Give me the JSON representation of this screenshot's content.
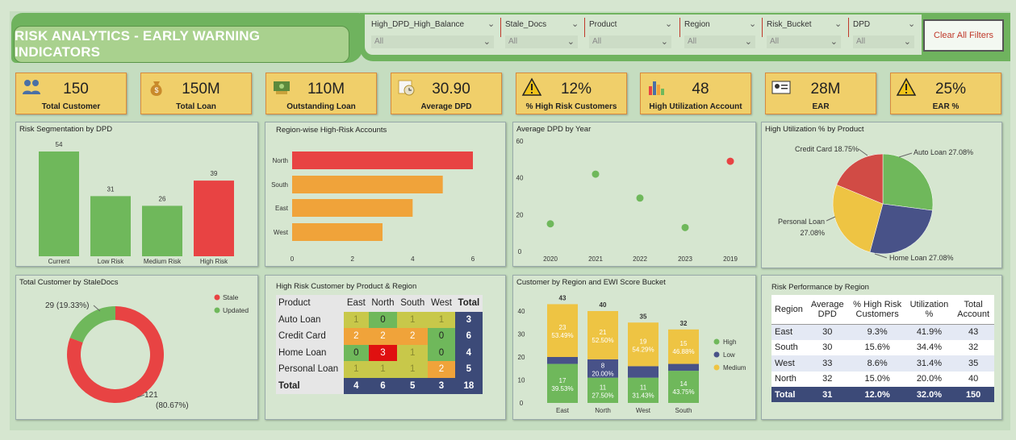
{
  "title": "RISK ANALYTICS - EARLY WARNING INDICATORS",
  "filters": [
    {
      "label": "High_DPD_High_Balance",
      "value": "All"
    },
    {
      "label": "Stale_Docs",
      "value": "All"
    },
    {
      "label": "Product",
      "value": "All"
    },
    {
      "label": "Region",
      "value": "All"
    },
    {
      "label": "Risk_Bucket",
      "value": "All"
    },
    {
      "label": "DPD",
      "value": "All"
    }
  ],
  "clear_label": "Clear All Filters",
  "kpis": [
    {
      "value": "150",
      "label": "Total Customer",
      "icon": "people-icon"
    },
    {
      "value": "150M",
      "label": "Total Loan",
      "icon": "money-bag-icon"
    },
    {
      "value": "110M",
      "label": "Outstanding Loan",
      "icon": "cash-icon"
    },
    {
      "value": "30.90",
      "label": "Average DPD",
      "icon": "calendar-clock-icon"
    },
    {
      "value": "12%",
      "label": "% High Risk Customers",
      "icon": "warning-icon"
    },
    {
      "value": "48",
      "label": "High Utilization Account",
      "icon": "bar-chart-icon"
    },
    {
      "value": "28M",
      "label": "EAR",
      "icon": "id-card-icon"
    },
    {
      "value": "25%",
      "label": "EAR %",
      "icon": "warning-icon"
    }
  ],
  "colors": {
    "green": "#6fb85b",
    "red": "#e84343",
    "orange": "#f0a33a",
    "yellow": "#eec443",
    "navy": "#485288"
  },
  "chart_data": [
    {
      "type": "bar",
      "title": "Risk Segmentation by DPD",
      "categories": [
        "Current",
        "Low Risk",
        "Medium Risk",
        "High Risk"
      ],
      "values": [
        54,
        31,
        26,
        39
      ],
      "colors": [
        "#6fb85b",
        "#6fb85b",
        "#6fb85b",
        "#e84343"
      ]
    },
    {
      "type": "bar",
      "orientation": "horizontal",
      "title": "Region-wise High-Risk Accounts",
      "categories": [
        "North",
        "South",
        "East",
        "West"
      ],
      "values": [
        6,
        5,
        4,
        3
      ],
      "xticks": [
        0,
        2,
        4,
        6
      ],
      "colors": [
        "#e84343",
        "#f0a33a",
        "#f0a33a",
        "#f0a33a"
      ]
    },
    {
      "type": "scatter",
      "title": "Average DPD by Year",
      "x": [
        "2020",
        "2021",
        "2022",
        "2023",
        "2019"
      ],
      "y": [
        15,
        42,
        29,
        13,
        49
      ],
      "yticks": [
        0,
        20,
        40,
        60
      ],
      "colors": [
        "#6fb85b",
        "#6fb85b",
        "#6fb85b",
        "#6fb85b",
        "#e84343"
      ]
    },
    {
      "type": "pie",
      "title": "High Utilization % by Product",
      "labels": [
        "Auto Loan 27.08%",
        "Home Loan 27.08%",
        "Personal Loan 27.08%",
        "Credit Card 18.75%"
      ],
      "values": [
        27.08,
        27.08,
        27.08,
        18.75
      ],
      "colors": [
        "#6fb85b",
        "#485288",
        "#eec443",
        "#d14b45"
      ]
    },
    {
      "type": "pie",
      "title": "Total Customer by StaleDocs",
      "labels": [
        "Stale",
        "Updated"
      ],
      "values": [
        121,
        29
      ],
      "data_labels": [
        "121\n(80.67%)",
        "29 (19.33%)"
      ],
      "colors": [
        "#e84343",
        "#6fb85b"
      ]
    },
    {
      "type": "bar",
      "stacked": true,
      "title": "Customer by Region and EWI Score Bucket",
      "categories": [
        "East",
        "North",
        "West",
        "South"
      ],
      "totals": [
        43,
        40,
        35,
        32
      ],
      "series": [
        {
          "name": "High",
          "values": [
            17,
            11,
            11,
            14
          ],
          "labels": [
            "17\n39.53%",
            "11\n27.50%",
            "11\n31.43%",
            "14\n43.75%"
          ],
          "color": "#6fb85b"
        },
        {
          "name": "Low",
          "values": [
            3,
            8,
            5,
            3
          ],
          "labels": [
            "",
            "8\n20.00%",
            "",
            ""
          ],
          "color": "#485288"
        },
        {
          "name": "Medium",
          "values": [
            23,
            21,
            19,
            15
          ],
          "labels": [
            "23\n53.49%",
            "21\n52.50%",
            "19\n54.29%",
            "15\n46.88%"
          ],
          "color": "#eec443"
        }
      ],
      "yticks": [
        0,
        10,
        20,
        30,
        40
      ]
    }
  ],
  "matrix": {
    "title": "High Risk Customer by Product & Region",
    "headers": [
      "Product",
      "East",
      "North",
      "South",
      "West",
      "Total"
    ],
    "rows": [
      {
        "name": "Auto Loan",
        "cells": [
          "1",
          "0",
          "1",
          "1"
        ],
        "total": "3"
      },
      {
        "name": "Credit Card",
        "cells": [
          "2",
          "2",
          "2",
          "0"
        ],
        "total": "6"
      },
      {
        "name": "Home Loan",
        "cells": [
          "0",
          "3",
          "1",
          "0"
        ],
        "total": "4"
      },
      {
        "name": "Personal Loan",
        "cells": [
          "1",
          "1",
          "1",
          "2"
        ],
        "total": "5"
      }
    ],
    "footer": {
      "name": "Total",
      "cells": [
        "4",
        "6",
        "5",
        "3"
      ],
      "total": "18"
    }
  },
  "perf": {
    "title": "Risk Performance by Region",
    "headers": [
      "Region",
      "Average DPD",
      "% High Risk Customers",
      "Utilization %",
      "Total Account"
    ],
    "rows": [
      [
        "East",
        "30",
        "9.3%",
        "41.9%",
        "43"
      ],
      [
        "South",
        "30",
        "15.6%",
        "34.4%",
        "32"
      ],
      [
        "West",
        "33",
        "8.6%",
        "31.4%",
        "35"
      ],
      [
        "North",
        "32",
        "15.0%",
        "20.0%",
        "40"
      ]
    ],
    "footer": [
      "Total",
      "31",
      "12.0%",
      "32.0%",
      "150"
    ]
  }
}
